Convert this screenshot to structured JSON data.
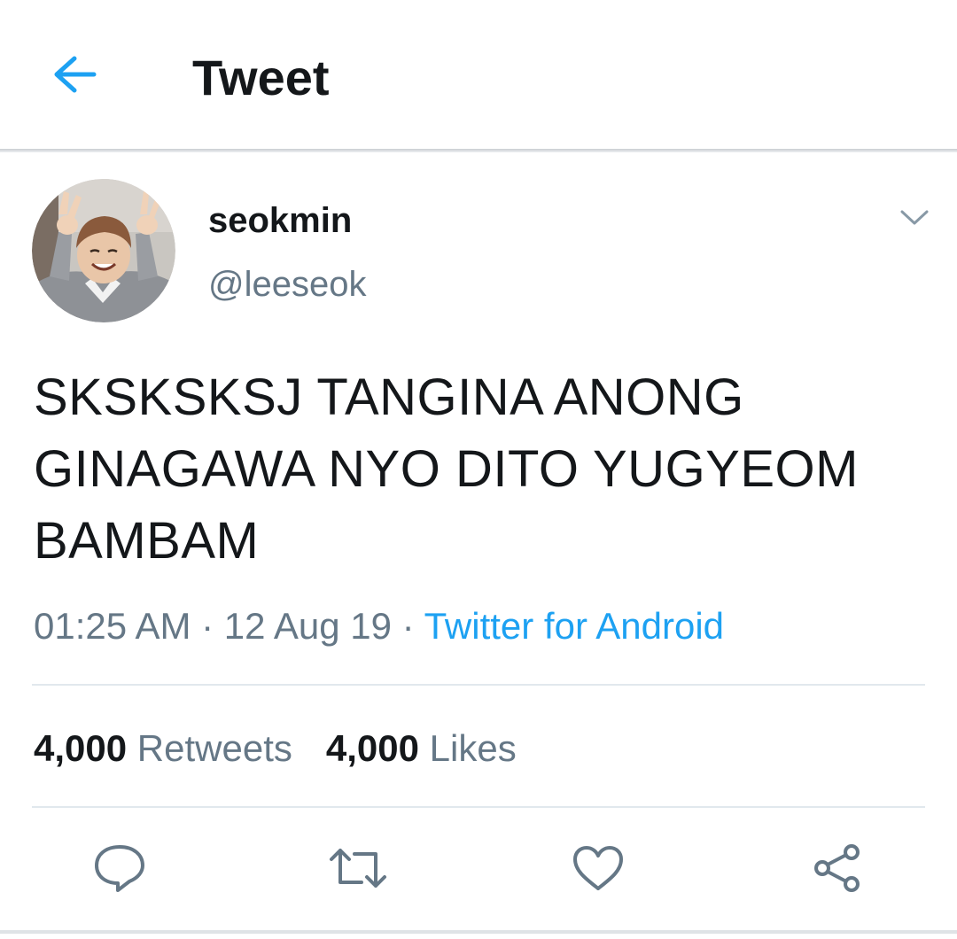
{
  "header": {
    "title": "Tweet",
    "back_icon": "arrow-left-icon",
    "accent_color": "#1da1f2"
  },
  "tweet": {
    "author": {
      "display_name": "seokmin",
      "handle": "@leeseok",
      "avatar_icon": "profile-photo"
    },
    "text_lines": [
      "SKSKSKSJ TANGINA ANONG",
      "GINAGAWA NYO DITO YUGYEOM",
      "BAMBAM"
    ],
    "time": "01:25 AM",
    "separator": " · ",
    "date": "12 Aug 19",
    "source": "Twitter for Android",
    "stats": {
      "retweets_count": "4,000",
      "retweets_label": "Retweets",
      "likes_count": "4,000",
      "likes_label": "Likes"
    }
  },
  "actions": {
    "reply_icon": "reply-icon",
    "retweet_icon": "retweet-icon",
    "like_icon": "heart-icon",
    "share_icon": "share-icon"
  },
  "colors": {
    "text": "#14171a",
    "secondary": "#657786",
    "link": "#1da1f2",
    "divider": "#e1e8ed"
  }
}
